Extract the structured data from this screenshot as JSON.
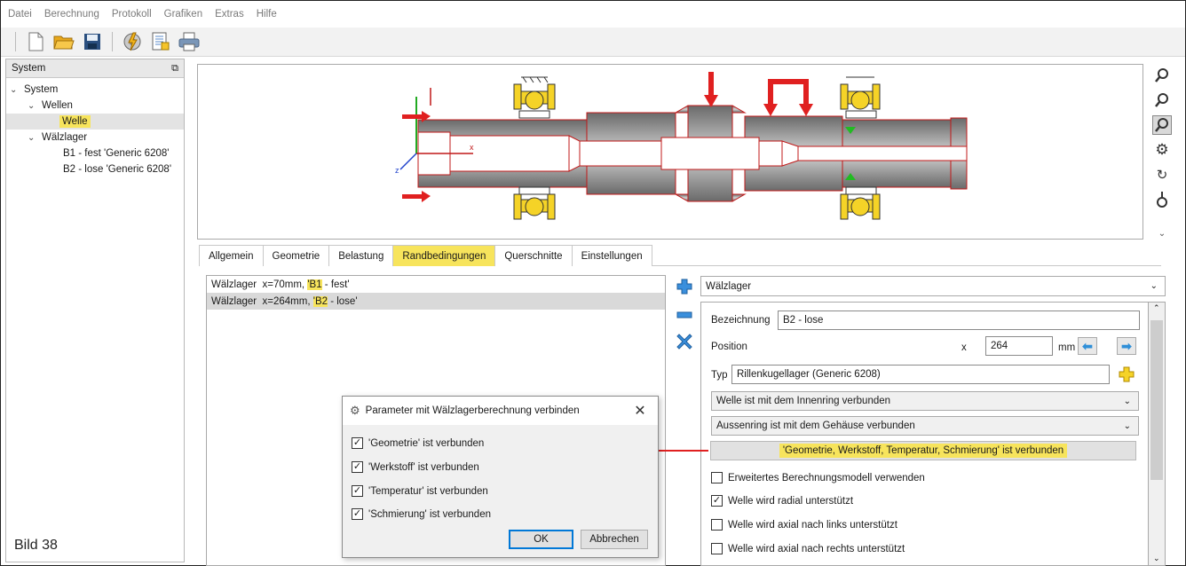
{
  "menu": [
    "Datei",
    "Berechnung",
    "Protokoll",
    "Grafiken",
    "Extras",
    "Hilfe"
  ],
  "toolbar_icons": [
    "new-file-icon",
    "open-folder-icon",
    "save-icon",
    "calculate-icon",
    "report-icon",
    "print-icon"
  ],
  "sidebar": {
    "title": "System",
    "tree": [
      {
        "label": "System",
        "level": 0,
        "expanded": true
      },
      {
        "label": "Wellen",
        "level": 1,
        "expanded": true
      },
      {
        "label": "Welle",
        "level": 2,
        "selected": true
      },
      {
        "label": "Wälzlager",
        "level": 1,
        "expanded": true
      },
      {
        "label": "B1 - fest 'Generic 6208'",
        "level": 2
      },
      {
        "label": "B2 - lose 'Generic 6208'",
        "level": 2
      }
    ]
  },
  "figure_caption": "Bild 38",
  "view_tools": [
    "zoom-fit-icon",
    "zoom-icon",
    "zoom-window-icon",
    "settings-gear-icon",
    "rotate-icon",
    "bearing-icon",
    "expand-icon"
  ],
  "tabs": [
    {
      "label": "Allgemein"
    },
    {
      "label": "Geometrie"
    },
    {
      "label": "Belastung"
    },
    {
      "label": "Randbedingungen",
      "active": true
    },
    {
      "label": "Querschnitte"
    },
    {
      "label": "Einstellungen"
    }
  ],
  "bc_list": [
    {
      "prefix": "Wälzlager  x=70mm, ",
      "quote_open": "'",
      "name": "B1",
      "suffix": " - fest'"
    },
    {
      "prefix": "Wälzlager  x=264mm, ",
      "quote_open": "'",
      "name": "B2",
      "suffix": " - lose'",
      "selected": true
    }
  ],
  "right": {
    "type_combo": "Wälzlager",
    "bezeichnung_label": "Bezeichnung",
    "bezeichnung_value": "B2 - lose",
    "position_label": "Position",
    "x_label": "x",
    "x_value": "264",
    "unit": "mm",
    "typ_label": "Typ",
    "typ_value": "Rillenkugellager (Generic 6208)",
    "inner_combo": "Welle ist mit dem Innenring verbunden",
    "outer_combo": "Aussenring ist mit dem Gehäuse verbunden",
    "status_button": "'Geometrie, Werkstoff, Temperatur, Schmierung' ist verbunden",
    "checkboxes": [
      {
        "label": "Erweitertes Berechnungsmodell verwenden",
        "checked": false
      },
      {
        "label": "Welle wird radial unterstützt",
        "checked": true
      },
      {
        "label": "Welle wird axial nach links unterstützt",
        "checked": false
      },
      {
        "label": "Welle wird axial nach rechts unterstützt",
        "checked": false
      }
    ]
  },
  "dialog": {
    "title": "Parameter mit Wälzlagerberechnung verbinden",
    "checks": [
      {
        "label": "'Geometrie' ist verbunden",
        "checked": true
      },
      {
        "label": "'Werkstoff' ist verbunden",
        "checked": true
      },
      {
        "label": "'Temperatur' ist verbunden",
        "checked": true
      },
      {
        "label": "'Schmierung' ist verbunden",
        "checked": true
      }
    ],
    "ok": "OK",
    "cancel": "Abbrechen"
  },
  "colors": {
    "highlight": "#f7e45c",
    "accent_blue": "#2f8fd8",
    "red": "#e02020",
    "bearing_yellow": "#f5d327"
  }
}
